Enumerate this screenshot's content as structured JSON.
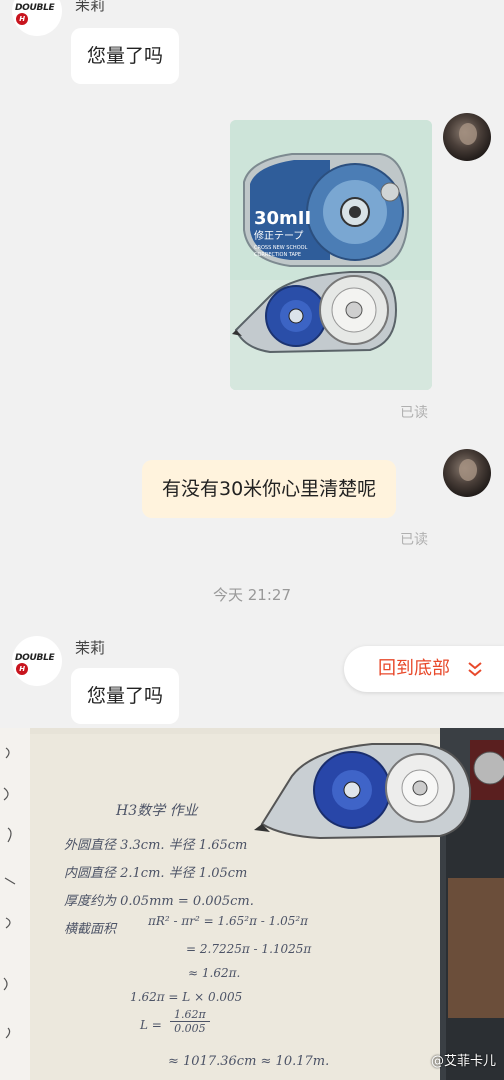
{
  "chat": {
    "sender_name": "茉莉",
    "avatar_logo_text": "DOUBLE",
    "avatar_logo_mark": "H",
    "msg1": "您量了吗",
    "msg2": "有没有30米你心里清楚呢",
    "read": "已读",
    "timestamp": "今天  21:27",
    "msg3": "您量了吗",
    "back_to_bottom": "回到底部"
  },
  "photo1": {
    "brand": "30mII",
    "subtitle": "修正テープ",
    "small1": "CROSS NEW SCHOOL",
    "small2": "CORRECTION TAPE"
  },
  "notes": {
    "title": "H3数学 作业",
    "line1": "外圆直径 3.3cm. 半径 1.65cm",
    "line2": "内圆直径 2.1cm. 半径 1.05cm",
    "line3": "厚度约为 0.05mm = 0.005cm.",
    "line4a": "横截面积",
    "line4b": "πR² - πr² = 1.65²π - 1.05²π",
    "line5": "= 2.7225π - 1.1025π",
    "line6": "≈ 1.62π.",
    "line7": "1.62π = L × 0.005",
    "line8a": "L = ",
    "line8num": "1.62π",
    "line8den": "0.005",
    "line9": "≈ 1017.36cm ≈ 10.17m."
  },
  "watermark": "@艾菲卡儿",
  "colors": {
    "accent": "#e8492b",
    "bubble_self": "#fff3dd",
    "bg": "#f1f1f1"
  }
}
